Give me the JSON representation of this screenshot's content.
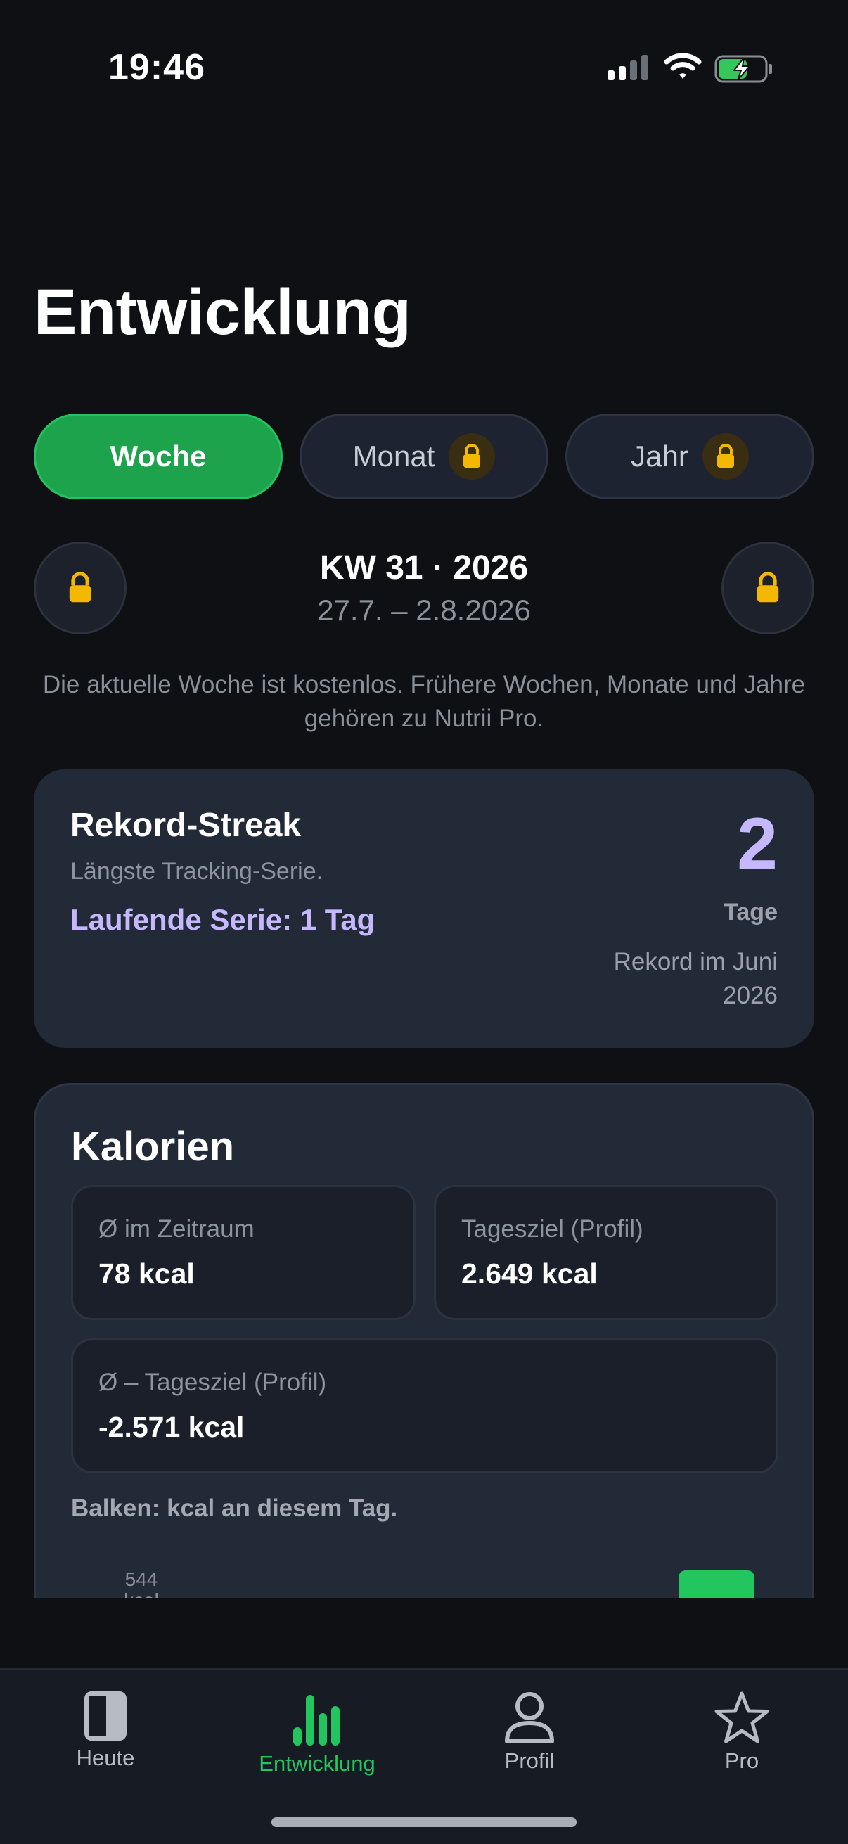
{
  "status_bar": {
    "time": "19:46",
    "icons": [
      "signal-icon",
      "wifi-icon",
      "battery-charging-icon"
    ]
  },
  "header": {
    "title": "Entwicklung"
  },
  "period_tabs": [
    {
      "label": "Woche",
      "active": true,
      "locked": false
    },
    {
      "label": "Monat",
      "active": false,
      "locked": true
    },
    {
      "label": "Jahr",
      "active": false,
      "locked": true
    }
  ],
  "week_nav": {
    "title": "KW 31 · 2026",
    "range": "27.7. – 2.8.2026",
    "prev_icon": "lock-icon",
    "next_icon": "lock-icon"
  },
  "info": {
    "text": "Die aktuelle Woche ist kostenlos. Frühere Wochen, Monate und Jahre gehören zu Nutrii Pro."
  },
  "streak": {
    "title": "Rekord-Streak",
    "subtitle": "Längste Tracking-Serie.",
    "current": "Laufende Serie: 1 Tag",
    "number": "2",
    "unit": "Tage",
    "record": "Rekord im Juni 2026"
  },
  "calories": {
    "title": "Kalorien",
    "stats": [
      {
        "label": "Ø im Zeitraum",
        "value": "78 kcal"
      },
      {
        "label": "Tagesziel (Profil)",
        "value": "2.649 kcal"
      },
      {
        "label": "Ø – Tagesziel (Profil)",
        "value": "-2.571 kcal"
      }
    ],
    "chart_note": "Balken: kcal an diesem Tag.",
    "axis_top_value": "544",
    "axis_top_unit": "kcal",
    "bar_color": "#22c55e"
  },
  "tab_bar": {
    "items": [
      {
        "label": "Heute",
        "icon": "book-icon",
        "active": false
      },
      {
        "label": "Entwicklung",
        "icon": "bar-chart-icon",
        "active": true
      },
      {
        "label": "Profil",
        "icon": "person-icon",
        "active": false
      },
      {
        "label": "Pro",
        "icon": "star-icon",
        "active": false
      }
    ]
  },
  "colors": {
    "background": "#0e1013",
    "accent": "#22c55e",
    "card": "#222a38",
    "streak_accent": "#c6b8ff",
    "lock": "#f5b800"
  }
}
